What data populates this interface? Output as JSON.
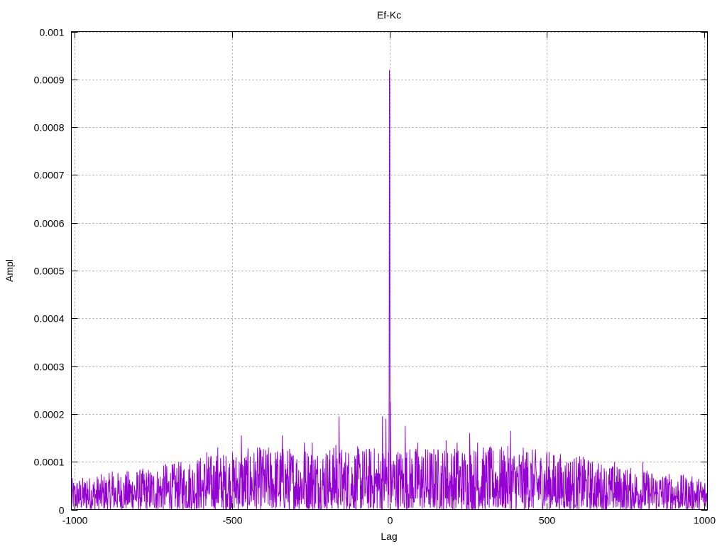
{
  "chart_data": {
    "type": "line",
    "title": "Ef-Kc",
    "xlabel": "Lag",
    "ylabel": "Ampl",
    "xlim": [
      -1010,
      1010
    ],
    "ylim": [
      0,
      0.001
    ],
    "grid": true,
    "x_ticks": [
      -1000,
      -500,
      0,
      500,
      1000
    ],
    "x_tick_labels": [
      "-1000",
      "-500",
      "0",
      "500",
      "1000"
    ],
    "y_ticks": [
      0,
      0.0001,
      0.0002,
      0.0003,
      0.0004,
      0.0005,
      0.0006,
      0.0007,
      0.0008,
      0.0009,
      0.001
    ],
    "y_tick_labels": [
      "0",
      "0.0001",
      "0.0002",
      "0.0003",
      "0.0004",
      "0.0005",
      "0.0006",
      "0.0007",
      "0.0008",
      "0.0009",
      "0.001"
    ],
    "series": [
      {
        "color": "#9400d3",
        "x_range": [
          -1010,
          1010
        ],
        "envelope": [
          [
            -1000,
            3.5e-05
          ],
          [
            -900,
            4e-05
          ],
          [
            -800,
            4.5e-05
          ],
          [
            -700,
            5e-05
          ],
          [
            -600,
            6e-05
          ],
          [
            -500,
            6.5e-05
          ],
          [
            -400,
            7e-05
          ],
          [
            -300,
            7e-05
          ],
          [
            -200,
            7e-05
          ],
          [
            -100,
            7e-05
          ],
          [
            100,
            7e-05
          ],
          [
            200,
            7e-05
          ],
          [
            300,
            7e-05
          ],
          [
            400,
            7e-05
          ],
          [
            500,
            6.5e-05
          ],
          [
            600,
            6e-05
          ],
          [
            700,
            5e-05
          ],
          [
            800,
            4.5e-05
          ],
          [
            900,
            4e-05
          ],
          [
            1000,
            3.5e-05
          ]
        ],
        "peaks": [
          {
            "x": 0,
            "y": 0.00092
          },
          {
            "x": 1,
            "y": 0.0009
          },
          {
            "x": -1,
            "y": 0.00022
          },
          {
            "x": 3,
            "y": 0.000225
          },
          {
            "x": -11,
            "y": 0.00019
          },
          {
            "x": -22,
            "y": 0.000195
          },
          {
            "x": -160,
            "y": 0.000195
          },
          {
            "x": 50,
            "y": 0.000175
          },
          {
            "x": 385,
            "y": 0.000165
          },
          {
            "x": 255,
            "y": 0.00016
          },
          {
            "x": -470,
            "y": 0.000155
          },
          {
            "x": -340,
            "y": 0.000155
          },
          {
            "x": 180,
            "y": 0.000145
          },
          {
            "x": 90,
            "y": 0.00014
          },
          {
            "x": 215,
            "y": 0.00014
          },
          {
            "x": 280,
            "y": 0.00014
          },
          {
            "x": -245,
            "y": 0.00014
          },
          {
            "x": -545,
            "y": 0.00013
          },
          {
            "x": -580,
            "y": 0.00012
          },
          {
            "x": -270,
            "y": 0.00014
          },
          {
            "x": -170,
            "y": 0.000135
          },
          {
            "x": 315,
            "y": 0.000125
          },
          {
            "x": 440,
            "y": 0.00012
          },
          {
            "x": 500,
            "y": 0.00012
          },
          {
            "x": 620,
            "y": 0.000105
          },
          {
            "x": 715,
            "y": 0.0001
          },
          {
            "x": 805,
            "y": 0.0001
          },
          {
            "x": -710,
            "y": 9.5e-05
          },
          {
            "x": -880,
            "y": 8e-05
          },
          {
            "x": -960,
            "y": 6e-05
          },
          {
            "x": 960,
            "y": 5.5e-05
          }
        ]
      }
    ]
  }
}
